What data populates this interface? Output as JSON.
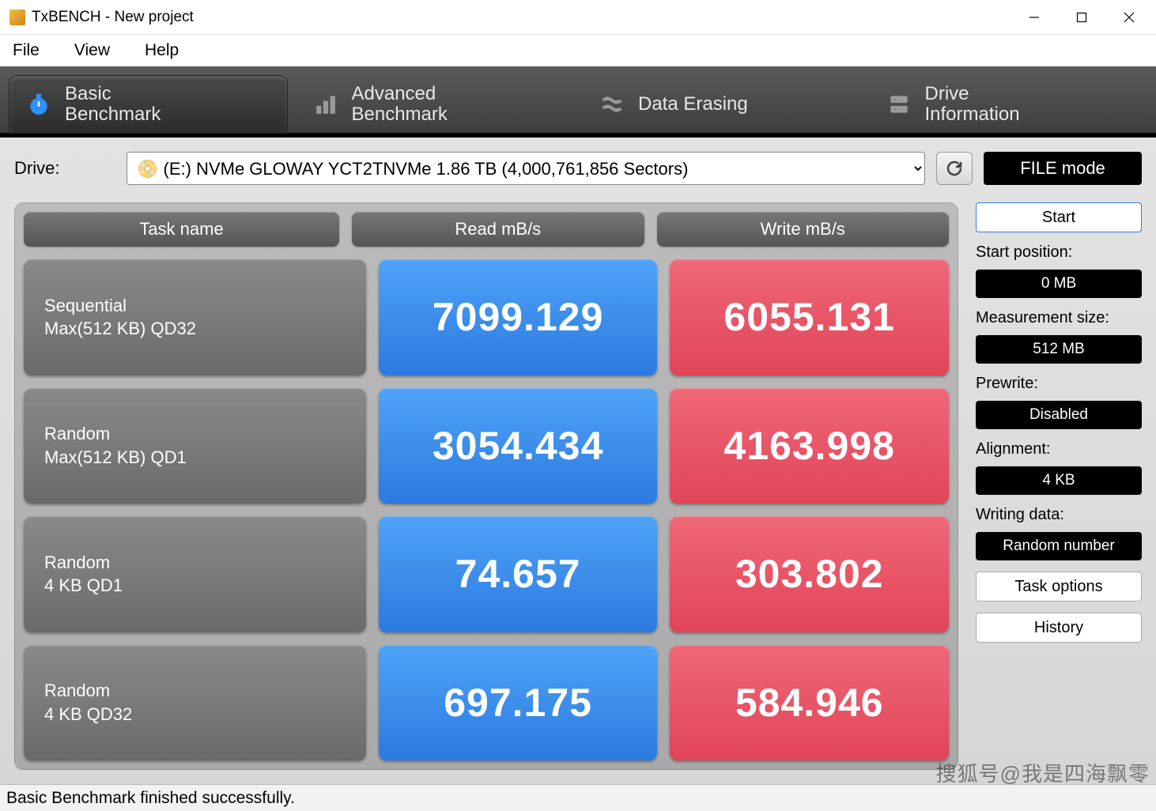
{
  "window": {
    "title": "TxBENCH - New project"
  },
  "menu": {
    "file": "File",
    "view": "View",
    "help": "Help"
  },
  "tabs": {
    "basic": {
      "l1": "Basic",
      "l2": "Benchmark"
    },
    "advanced": {
      "l1": "Advanced",
      "l2": "Benchmark"
    },
    "erase": {
      "l1": "Data Erasing"
    },
    "drive": {
      "l1": "Drive",
      "l2": "Information"
    }
  },
  "drive": {
    "label": "Drive:",
    "value": "(E:) NVMe GLOWAY YCT2TNVMe  1.86 TB (4,000,761,856 Sectors)",
    "filemode": "FILE mode"
  },
  "headers": {
    "task": "Task name",
    "read": "Read mB/s",
    "write": "Write mB/s"
  },
  "rows": [
    {
      "t1": "Sequential",
      "t2": "Max(512 KB) QD32",
      "read": "7099.129",
      "write": "6055.131"
    },
    {
      "t1": "Random",
      "t2": "Max(512 KB) QD1",
      "read": "3054.434",
      "write": "4163.998"
    },
    {
      "t1": "Random",
      "t2": "4 KB QD1",
      "read": "74.657",
      "write": "303.802"
    },
    {
      "t1": "Random",
      "t2": "4 KB QD32",
      "read": "697.175",
      "write": "584.946"
    }
  ],
  "side": {
    "start": "Start",
    "startpos_l": "Start position:",
    "startpos_v": "0 MB",
    "msize_l": "Measurement size:",
    "msize_v": "512 MB",
    "prewrite_l": "Prewrite:",
    "prewrite_v": "Disabled",
    "align_l": "Alignment:",
    "align_v": "4 KB",
    "wdata_l": "Writing data:",
    "wdata_v": "Random number",
    "taskopt": "Task options",
    "history": "History"
  },
  "status": "Basic Benchmark finished successfully.",
  "watermark": "搜狐号@我是四海飘零"
}
